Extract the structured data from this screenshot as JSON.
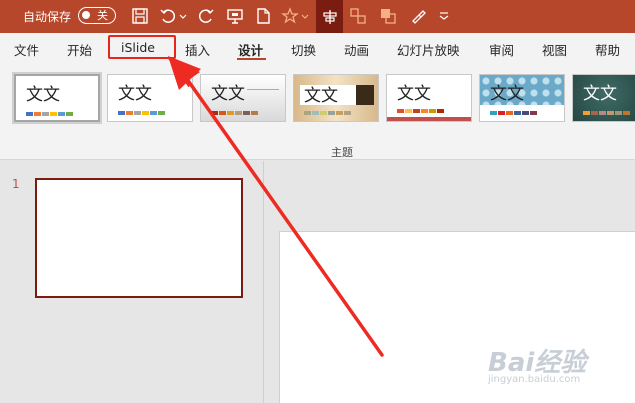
{
  "titlebar": {
    "autosave_label": "自动保存",
    "toggle_label": "关"
  },
  "tabs": [
    {
      "label": "文件"
    },
    {
      "label": "开始"
    },
    {
      "label": "iSlide"
    },
    {
      "label": "插入"
    },
    {
      "label": "设计"
    },
    {
      "label": "切换"
    },
    {
      "label": "动画"
    },
    {
      "label": "幻灯片放映"
    },
    {
      "label": "审阅"
    },
    {
      "label": "视图"
    },
    {
      "label": "帮助"
    }
  ],
  "selected_tab": "设计",
  "themes": [
    {
      "sample": "文文",
      "style": "Office",
      "colors": [
        "#4472c4",
        "#ed7d31",
        "#a5a5a5",
        "#ffc000",
        "#5b9bd5",
        "#70ad47"
      ]
    },
    {
      "sample": "文文",
      "style": "Office",
      "colors": [
        "#4472c4",
        "#ed7d31",
        "#a5a5a5",
        "#ffc000",
        "#5b9bd5",
        "#70ad47"
      ]
    },
    {
      "sample": "文文",
      "style": "gray-gradient",
      "colors": [
        "#a5300f",
        "#d55816",
        "#e19825",
        "#b19c7d",
        "#7f5f52",
        "#b27d49"
      ]
    },
    {
      "sample": "文文",
      "style": "wood",
      "colors": [
        "#a9a57c",
        "#9cbebd",
        "#d2cb6c",
        "#95a39d",
        "#c89f5d",
        "#b1a089"
      ]
    },
    {
      "sample": "文文",
      "style": "red-band",
      "colors": [
        "#e84c22",
        "#ffbd47",
        "#b64926",
        "#ff8427",
        "#cc9900",
        "#b22600"
      ]
    },
    {
      "sample": "文文",
      "style": "blue-pattern",
      "colors": [
        "#2da2bf",
        "#da1f28",
        "#eb641b",
        "#39639d",
        "#474b78",
        "#7d3c4a"
      ]
    },
    {
      "sample": "文文",
      "style": "dark-teal",
      "colors": [
        "#f0a22e",
        "#a5644e",
        "#b58b80",
        "#c3986d",
        "#a19574",
        "#c17529"
      ]
    }
  ],
  "ribbon_group_label": "主题",
  "slides": [
    {
      "number": "1"
    }
  ],
  "watermark": {
    "main": "Bai经验",
    "sub": "jingyan.baidu.com"
  },
  "colors": {
    "titlebar": "#b7472a",
    "highlight_box": "#e8251b",
    "arrow": "#ee2b22",
    "thumb_border": "#7a1d10"
  }
}
